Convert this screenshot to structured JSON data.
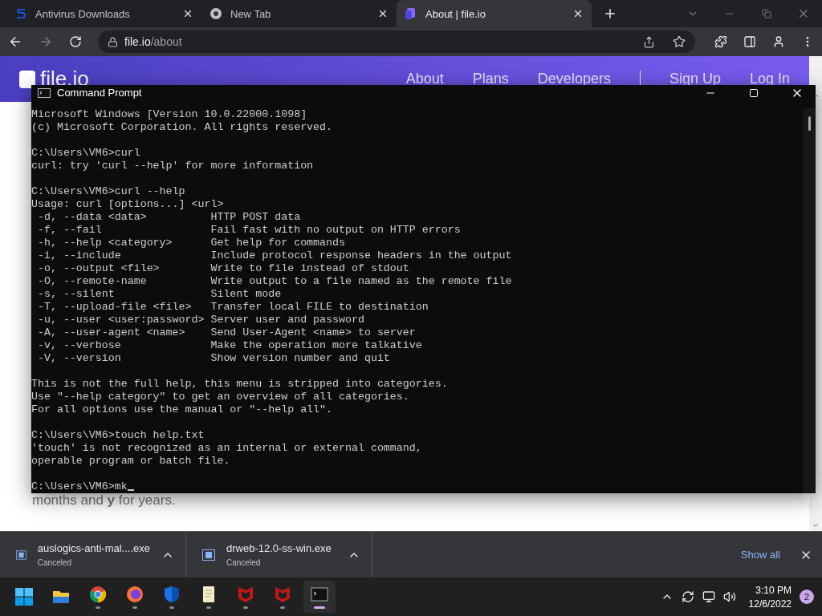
{
  "browser": {
    "tabs": [
      {
        "title": "Antivirus Downloads",
        "kind": "s",
        "selected": false
      },
      {
        "title": "New Tab",
        "kind": "chrome",
        "selected": false
      },
      {
        "title": "About | file.io",
        "kind": "fileio",
        "selected": true
      }
    ],
    "address": {
      "host": "file.io",
      "path": "/about"
    }
  },
  "site": {
    "logo": "file.io",
    "nav": [
      "About",
      "Plans",
      "Developers",
      "Sign Up",
      "Log In"
    ],
    "body_text": "months and **y** for years."
  },
  "terminal": {
    "title": "Command Prompt",
    "blocks": [
      [
        "Microsoft Windows [Version 10.0.22000.1098]",
        "(c) Microsoft Corporation. All rights reserved."
      ],
      [
        "C:\\Users\\VM6>curl",
        "curl: try 'curl --help' for more information"
      ],
      [
        "C:\\Users\\VM6>curl --help",
        "Usage: curl [options...] <url>",
        " -d, --data <data>          HTTP POST data",
        " -f, --fail                 Fail fast with no output on HTTP errors",
        " -h, --help <category>      Get help for commands",
        " -i, --include              Include protocol response headers in the output",
        " -o, --output <file>        Write to file instead of stdout",
        " -O, --remote-name          Write output to a file named as the remote file",
        " -s, --silent               Silent mode",
        " -T, --upload-file <file>   Transfer local FILE to destination",
        " -u, --user <user:password> Server user and password",
        " -A, --user-agent <name>    Send User-Agent <name> to server",
        " -v, --verbose              Make the operation more talkative",
        " -V, --version              Show version number and quit"
      ],
      [
        "This is not the full help, this menu is stripped into categories.",
        "Use \"--help category\" to get an overview of all categories.",
        "For all options use the manual or \"--help all\"."
      ],
      [
        "C:\\Users\\VM6>touch help.txt",
        "'touch' is not recognized as an internal or external command,",
        "operable program or batch file."
      ]
    ],
    "prompt": "C:\\Users\\VM6>mk"
  },
  "downloads": {
    "items": [
      {
        "name": "auslogics-anti-mal....exe",
        "status": "Canceled"
      },
      {
        "name": "drweb-12.0-ss-win.exe",
        "status": "Canceled"
      }
    ],
    "show_all": "Show all"
  },
  "taskbar": {
    "apps": [
      {
        "kind": "start",
        "running": false,
        "selected": false
      },
      {
        "kind": "folder",
        "running": false,
        "selected": false
      },
      {
        "kind": "chrome",
        "running": true,
        "selected": false
      },
      {
        "kind": "firefox",
        "running": true,
        "selected": false
      },
      {
        "kind": "shield",
        "running": true,
        "selected": false
      },
      {
        "kind": "notepad",
        "running": true,
        "selected": false
      },
      {
        "kind": "mcafee",
        "running": true,
        "selected": false
      },
      {
        "kind": "mcafee",
        "running": true,
        "selected": false
      },
      {
        "kind": "terminal",
        "running": true,
        "selected": true
      }
    ],
    "time": "3:10 PM",
    "date": "12/6/2022",
    "notifications": "2"
  }
}
